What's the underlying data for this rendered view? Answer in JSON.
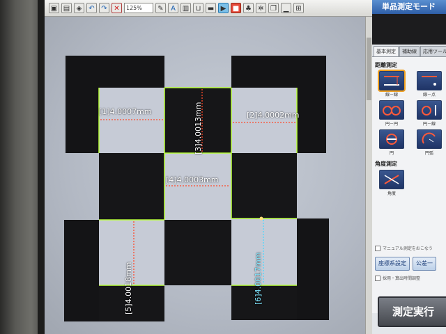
{
  "toolbar": {
    "zoom_value": "125%",
    "buttons": [
      {
        "name": "image-icon",
        "glyph": "▣"
      },
      {
        "name": "save-icon",
        "glyph": "▤"
      },
      {
        "name": "camera-icon",
        "glyph": "◈"
      },
      {
        "name": "undo-icon",
        "glyph": "↶"
      },
      {
        "name": "redo-icon",
        "glyph": "↷"
      },
      {
        "name": "delete-icon",
        "glyph": "✕"
      }
    ],
    "tools": [
      {
        "name": "pencil-icon",
        "glyph": "✎"
      },
      {
        "name": "text-overlay-icon",
        "glyph": "A"
      },
      {
        "name": "pattern-icon",
        "glyph": "▥"
      },
      {
        "name": "bracket-icon",
        "glyph": "⊔"
      },
      {
        "name": "bar-icon",
        "glyph": "▬"
      },
      {
        "name": "play-icon",
        "glyph": "▶"
      },
      {
        "name": "record-icon",
        "glyph": "■"
      },
      {
        "name": "tree-icon",
        "glyph": "♣"
      },
      {
        "name": "settings-icon",
        "glyph": "✲"
      },
      {
        "name": "copy-icon",
        "glyph": "❐"
      },
      {
        "name": "minimize-icon",
        "glyph": "▁"
      },
      {
        "name": "calc-icon",
        "glyph": "⊞"
      }
    ]
  },
  "measurements": [
    {
      "id": "m1",
      "text": "[1]4.0007mm"
    },
    {
      "id": "m2",
      "text": "[2]4.0002mm"
    },
    {
      "id": "m3",
      "text": "[3]4.0013mm"
    },
    {
      "id": "m4",
      "text": "[4]4.0003mm"
    },
    {
      "id": "m5",
      "text": "[5]4.0018mm"
    },
    {
      "id": "m6",
      "text": "[6]4.0017mm"
    }
  ],
  "panel": {
    "title": "単品測定モード",
    "tabs": [
      "基本測定",
      "補助線",
      "応用ツール"
    ],
    "section_distance": "距離測定",
    "tools": [
      {
        "name": "line-to-line-tool",
        "caption": "線－線"
      },
      {
        "name": "line-to-point-tool",
        "caption": "線－点"
      },
      {
        "name": "circle-to-circle-tool",
        "caption": "円－円"
      },
      {
        "name": "circle-to-line-tool",
        "caption": "円－線"
      },
      {
        "name": "circle-tool",
        "caption": "円"
      },
      {
        "name": "arc-tool",
        "caption": "円弧"
      }
    ],
    "section_angle": "角度測定",
    "angle_caption": "角度",
    "manual_check": "マニュアル測定をおこなう",
    "coord_button": "座標系設定",
    "tolerance_button": "公差一",
    "time_check": "採用・算出時間調整",
    "run_button": "測定実行"
  },
  "colors": {
    "edge_line": "#b8ff3a",
    "measure_line": "#ff4a2a",
    "measure_line_cyan": "#4ad8ff"
  }
}
